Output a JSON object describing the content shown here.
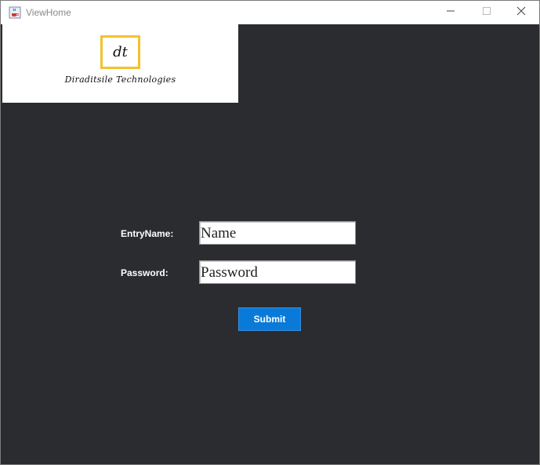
{
  "window": {
    "title": "ViewHome",
    "icons": {
      "app": "java-cup-icon",
      "minimize": "minimize-icon",
      "maximize": "maximize-icon",
      "close": "close-icon"
    }
  },
  "logo": {
    "mark": "dt",
    "company": "Diraditsile Technologies",
    "accent_color": "#f2c12e"
  },
  "form": {
    "entry_name_label": "EntryName:",
    "entry_name_value": "Name",
    "password_label": "Password:",
    "password_value": "Password",
    "submit_label": "Submit"
  },
  "colors": {
    "background": "#2b2c2f",
    "button": "#0a7ad8"
  }
}
